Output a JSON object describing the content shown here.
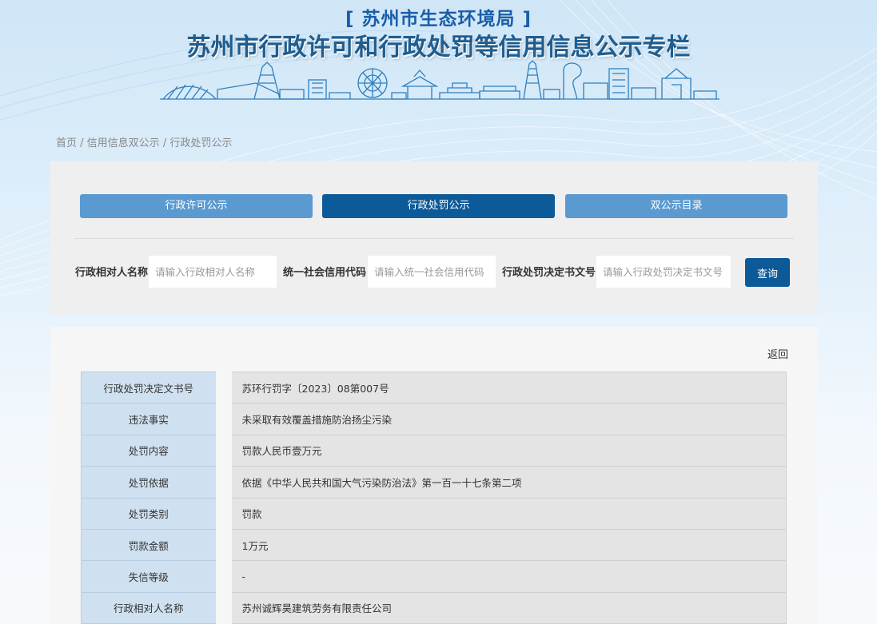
{
  "banner": {
    "org": "[ 苏州市生态环境局 ]",
    "title": "苏州市行政许可和行政处罚等信用信息公示专栏"
  },
  "breadcrumb": [
    "首页",
    "信用信息双公示",
    "行政处罚公示"
  ],
  "breadcrumb_sep": " / ",
  "tabs": [
    {
      "label": "行政许可公示",
      "active": false
    },
    {
      "label": "行政处罚公示",
      "active": true
    },
    {
      "label": "双公示目录",
      "active": false
    }
  ],
  "search": {
    "fields": [
      {
        "label": "行政相对人名称",
        "placeholder": "请输入行政相对人名称"
      },
      {
        "label": "统一社会信用代码",
        "placeholder": "请输入统一社会信用代码"
      },
      {
        "label": "行政处罚决定书文号",
        "placeholder": "请输入行政处罚决定书文号"
      }
    ],
    "button": "查询"
  },
  "detail": {
    "back": "返回",
    "rows": [
      {
        "key": "行政处罚决定文书号",
        "value": "苏环行罚字〔2023〕08第007号"
      },
      {
        "key": "违法事实",
        "value": "未采取有效覆盖措施防治扬尘污染"
      },
      {
        "key": "处罚内容",
        "value": "罚款人民币壹万元"
      },
      {
        "key": "处罚依据",
        "value": "依据《中华人民共和国大气污染防治法》第一百一十七条第二项"
      },
      {
        "key": "处罚类别",
        "value": "罚款"
      },
      {
        "key": "罚款金额",
        "value": "1万元"
      },
      {
        "key": "失信等级",
        "value": "-"
      },
      {
        "key": "行政相对人名称",
        "value": "苏州诚辉昊建筑劳务有限责任公司"
      }
    ]
  },
  "colors": {
    "primary": "#0d5a98",
    "tab": "#5a9ad0",
    "key_cell": "#cfe0f0",
    "value_cell": "#e4e4e4"
  }
}
